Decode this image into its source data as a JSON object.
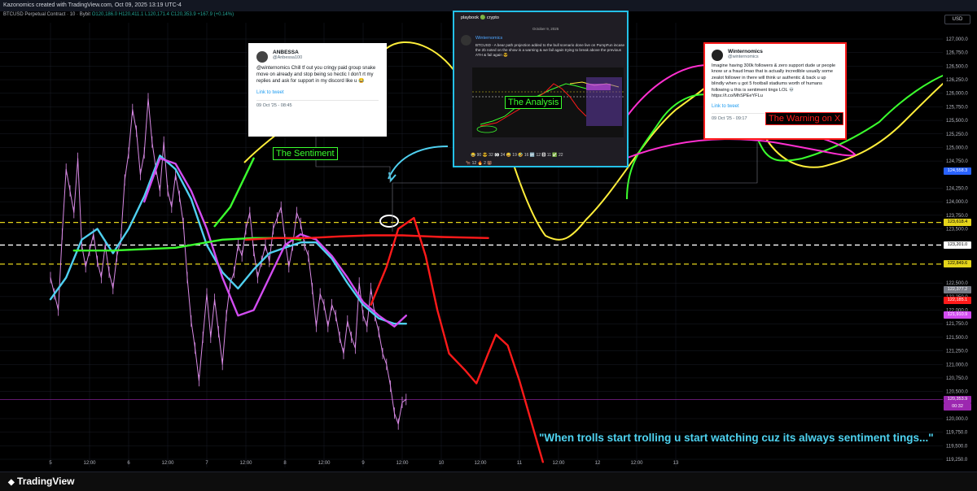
{
  "top_bar": {
    "title": "Kazonomics created with TradingView.com, Oct 09, 2025 13:19 UTC-4"
  },
  "legend": {
    "symbol": "BTCUSD Perpetual Contract · 10 · Bybit",
    "ohlc": "O120,186.0 H120,411.1 L120,171.4 C120,353.9 +167.9 (+0.14%)"
  },
  "currency": "USD",
  "colors": {
    "background": "#000000",
    "cyan_ma": "#4fd0f0",
    "magenta_ma": "#d24cf0",
    "green": "#3bff2e",
    "red": "#ff1a1a",
    "yellow": "#ffee3a",
    "pink": "#ff2fd0",
    "candles": "#d98ae6"
  },
  "chart_data": {
    "type": "line",
    "title": "",
    "ylim": [
      119100,
      127300
    ],
    "y_ticks": [
      "127,000.0",
      "126,750.0",
      "126,500.0",
      "126,250.0",
      "126,000.0",
      "125,750.0",
      "125,500.0",
      "125,250.0",
      "125,000.0",
      "124,750.0",
      "124,250.0",
      "124,000.0",
      "123,750.0",
      "123,500.0",
      "122,500.0",
      "122,250.0",
      "122,000.0",
      "121,750.0",
      "121,500.0",
      "121,250.0",
      "121,000.0",
      "120,750.0",
      "120,500.0",
      "120,000.0",
      "119,750.0",
      "119,500.0",
      "119,250.0"
    ],
    "x_ticks": [
      "5",
      "12:00",
      "6",
      "12:00",
      "7",
      "12:00",
      "8",
      "12:00",
      "9",
      "12:00",
      "10",
      "12:00",
      "11",
      "12:00",
      "12",
      "12:00",
      "13"
    ],
    "price_tags": [
      {
        "label": "124,558.3",
        "color": "#2962ff"
      },
      {
        "label": "123,618.4",
        "color": "#e4d41b"
      },
      {
        "label": "123,201.0",
        "color": "#ffffff"
      },
      {
        "label": "122,849.6",
        "color": "#e4d41b"
      },
      {
        "label": "122,377.2",
        "color": "#787b86"
      },
      {
        "label": "122,185.1",
        "color": "#ff1a1a"
      },
      {
        "label": "121,910.9",
        "color": "#d24cf0"
      },
      {
        "label": "120,353.9",
        "color": "#9c27b0"
      },
      {
        "label": "00:32",
        "color": "#9c27b0"
      }
    ],
    "levels": [
      {
        "name": "upper-dashed",
        "value": 123618.4,
        "color": "#e4d41b"
      },
      {
        "name": "mid-dashed",
        "value": 123201.0,
        "color": "#ffffff"
      },
      {
        "name": "lower-dashed",
        "value": 122849.6,
        "color": "#e4d41b"
      }
    ],
    "series": [
      {
        "color": "#d98ae6",
        "x": [
          0,
          0.05,
          0.1,
          0.15,
          0.2,
          0.25,
          0.3,
          0.35,
          0.4,
          0.45,
          0.5,
          0.55,
          0.6,
          0.65,
          0.7,
          0.75,
          0.8,
          0.85,
          0.9,
          0.95,
          1.0,
          1.05,
          1.1,
          1.15,
          1.2,
          1.25,
          1.3,
          1.35,
          1.4,
          1.45,
          1.5,
          1.55,
          1.6,
          1.65,
          1.7,
          1.75,
          1.8,
          1.85,
          1.9,
          1.95,
          2.0,
          2.05,
          2.1,
          2.15,
          2.2,
          2.25,
          2.3,
          2.35,
          2.4,
          2.45,
          2.5,
          2.55,
          2.6,
          2.65,
          2.7,
          2.75,
          2.8,
          2.85,
          2.9,
          2.95,
          3.0,
          3.05,
          3.1,
          3.15,
          3.2,
          3.25,
          3.3,
          3.35,
          3.4,
          3.45,
          3.5,
          3.55,
          3.6,
          3.65,
          3.7,
          3.75,
          3.8,
          3.85,
          3.9,
          3.95,
          4.0,
          4.05,
          4.1,
          4.15,
          4.2,
          4.25,
          4.3,
          4.35,
          4.4,
          4.45,
          4.5,
          4.55
        ],
        "y": [
          122600,
          122300,
          122000,
          123400,
          124600,
          124200,
          123800,
          124800,
          123200,
          122800,
          123100,
          123400,
          122900,
          122600,
          123200,
          122700,
          122400,
          123000,
          123300,
          124400,
          124900,
          125700,
          125300,
          124500,
          124900,
          125900,
          125100,
          124600,
          124200,
          125100,
          124200,
          123900,
          124500,
          124100,
          123600,
          122600,
          121800,
          121300,
          120700,
          121500,
          122300,
          121500,
          122200,
          121600,
          121000,
          121900,
          122500,
          122700,
          123200,
          123000,
          123500,
          123800,
          123100,
          122600,
          122900,
          123200,
          122900,
          123500,
          123700,
          123900,
          123300,
          122800,
          123200,
          123800,
          123600,
          123200,
          123000,
          122400,
          121700,
          122300,
          122100,
          121700,
          122100,
          121900,
          121500,
          121200,
          121800,
          121500,
          121300,
          122500,
          121900,
          121700,
          122400,
          121900,
          121600,
          121200,
          121000,
          120600,
          120100,
          119900,
          120300,
          120354
        ]
      },
      {
        "color": "#4fd0f0",
        "x": [
          0,
          0.2,
          0.4,
          0.6,
          0.8,
          1.0,
          1.2,
          1.4,
          1.6,
          1.8,
          2.0,
          2.2,
          2.4,
          2.6,
          2.8,
          3.0,
          3.2,
          3.4,
          3.6,
          3.8,
          4.0,
          4.2,
          4.4,
          4.55
        ],
        "y": [
          122200,
          122600,
          123300,
          123500,
          123050,
          123500,
          124100,
          124850,
          124600,
          124050,
          123200,
          122700,
          122400,
          122750,
          123050,
          123150,
          123250,
          123250,
          122950,
          122500,
          122100,
          121850,
          121750,
          121750
        ]
      },
      {
        "color": "#d24cf0",
        "x": [
          1.2,
          1.4,
          1.6,
          1.8,
          2.0,
          2.2,
          2.4,
          2.6,
          2.8,
          3.0,
          3.2,
          3.4,
          3.6,
          3.8,
          4.0,
          4.2,
          4.4,
          4.55
        ],
        "y": [
          124000,
          124800,
          124700,
          124200,
          123500,
          122600,
          121900,
          122000,
          122600,
          123200,
          123400,
          123300,
          123000,
          122600,
          122150,
          121900,
          121700,
          121900
        ]
      },
      {
        "color": "#3bff2e",
        "x": [
          0.3,
          0.8,
          1.6,
          2.2,
          2.6,
          3.0,
          3.2
        ],
        "y": [
          123100,
          123100,
          123150,
          123300,
          123330,
          123330,
          123300
        ]
      },
      {
        "color": "#3bff2e",
        "x": [
          2.1,
          2.3,
          2.45,
          2.6
        ],
        "y": [
          123550,
          123900,
          124350,
          124800
        ]
      },
      {
        "color": "#ff1a1a",
        "x": [
          2.5,
          2.9,
          3.3,
          3.7,
          4.1,
          4.5,
          5.0,
          5.6
        ],
        "y": [
          123300,
          123330,
          123330,
          123360,
          123380,
          123380,
          123350,
          123330
        ]
      },
      {
        "color": "#ff1a1a",
        "x": [
          4.1,
          4.3,
          4.45,
          4.65,
          4.8,
          4.95,
          5.1,
          5.3,
          5.45,
          5.6,
          5.7,
          5.85,
          6.0,
          6.3
        ],
        "y": [
          122100,
          122800,
          123500,
          123700,
          123000,
          122000,
          121200,
          120900,
          120650,
          121200,
          121550,
          121350,
          120700,
          119200
        ]
      }
    ]
  },
  "labels": {
    "sentiment": "The Sentiment",
    "analysis": "The Analysis",
    "warning": "The Warning on X",
    "quote": "\"When trolls start trolling u start watching cuz its always sentiment tings...\""
  },
  "tweet_left": {
    "name": "ANBESSA",
    "handle": "@Anbessa100",
    "text": "@winternomics Chill tf out you cringy paid group snake move on already and stop being so hectic I don't rt my replies and ask for support in my discord like u 😂",
    "link": "Link to tweet",
    "date": "09 Oct '25 - 08:45"
  },
  "tweet_right": {
    "name": "Winternomics",
    "handle": "@winternomics",
    "text": "Imagine having 300k followers & zero support dude ur people know ur a fraud lmao that is actually incredible usually some zealot follower in there will think ur authentic & back u up blindly when u got 5 football stadiums worth of humans following u this is sentiment tings LOL 💀 https://t.co/MhSPEeYFLu",
    "link": "Link to tweet",
    "date": "09 Oct '25 - 09:17"
  },
  "discord": {
    "channel": "playbook 🟢 crypto",
    "date": "October 9, 2025",
    "user": "Winternomics",
    "text": "BTCUSD - A bear path projection added to the bull scenario done live on PumpFun incase the 2b noted on the show is a warning & we fail again trying to break above the previous ATH & fail again 😎",
    "reactions": "😂 90   😎 32   👀 24   😅 19   🤣 16   🆙 12   🅱 11   ✅ 22",
    "reactions2": "🐂 12   🔥 2   🐻"
  },
  "footer": {
    "logo": "TradingView"
  }
}
